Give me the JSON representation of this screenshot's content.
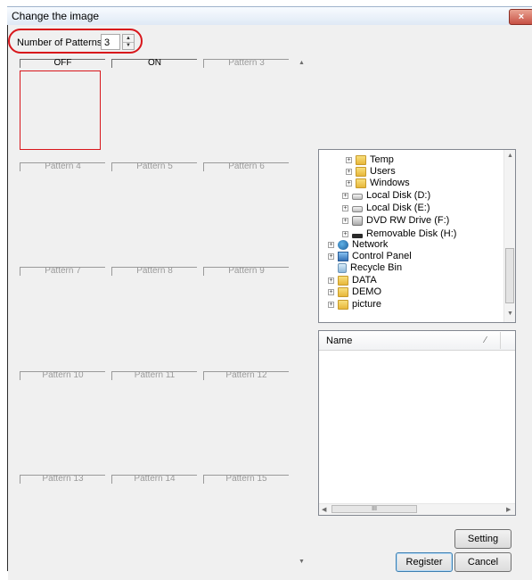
{
  "window": {
    "title": "Change the image",
    "close_label": "×"
  },
  "number_of_patterns": {
    "label": "Number of Patterns",
    "value": "3"
  },
  "patterns": [
    {
      "label": "OFF"
    },
    {
      "label": "ON"
    },
    {
      "label": "Pattern 3"
    },
    {
      "label": "Pattern 4"
    },
    {
      "label": "Pattern 5"
    },
    {
      "label": "Pattern 6"
    },
    {
      "label": "Pattern 7"
    },
    {
      "label": "Pattern 8"
    },
    {
      "label": "Pattern 9"
    },
    {
      "label": "Pattern 10"
    },
    {
      "label": "Pattern 11"
    },
    {
      "label": "Pattern 12"
    },
    {
      "label": "Pattern 13"
    },
    {
      "label": "Pattern 14"
    },
    {
      "label": "Pattern 15"
    }
  ],
  "folder_tree": {
    "items": [
      {
        "label": "Temp",
        "icon": "folder-icon"
      },
      {
        "label": "Users",
        "icon": "folder-icon"
      },
      {
        "label": "Windows",
        "icon": "folder-icon"
      },
      {
        "label": "Local Disk (D:)",
        "icon": "disk-icon"
      },
      {
        "label": "Local Disk (E:)",
        "icon": "disk-icon"
      },
      {
        "label": "DVD RW Drive (F:)",
        "icon": "dvd-icon"
      },
      {
        "label": "Removable Disk (H:)",
        "icon": "removable-disk-icon"
      },
      {
        "label": "Network",
        "icon": "network-icon"
      },
      {
        "label": "Control Panel",
        "icon": "control-panel-icon"
      },
      {
        "label": "Recycle Bin",
        "icon": "recycle-bin-icon"
      },
      {
        "label": "DATA",
        "icon": "folder-icon"
      },
      {
        "label": "DEMO",
        "icon": "folder-icon"
      },
      {
        "label": "picture",
        "icon": "folder-icon"
      }
    ]
  },
  "file_list": {
    "column_name": "Name",
    "scroll_grip": "III"
  },
  "buttons": {
    "setting": "Setting",
    "register": "Register",
    "cancel": "Cancel"
  },
  "colors": {
    "highlight": "#d8161b"
  }
}
